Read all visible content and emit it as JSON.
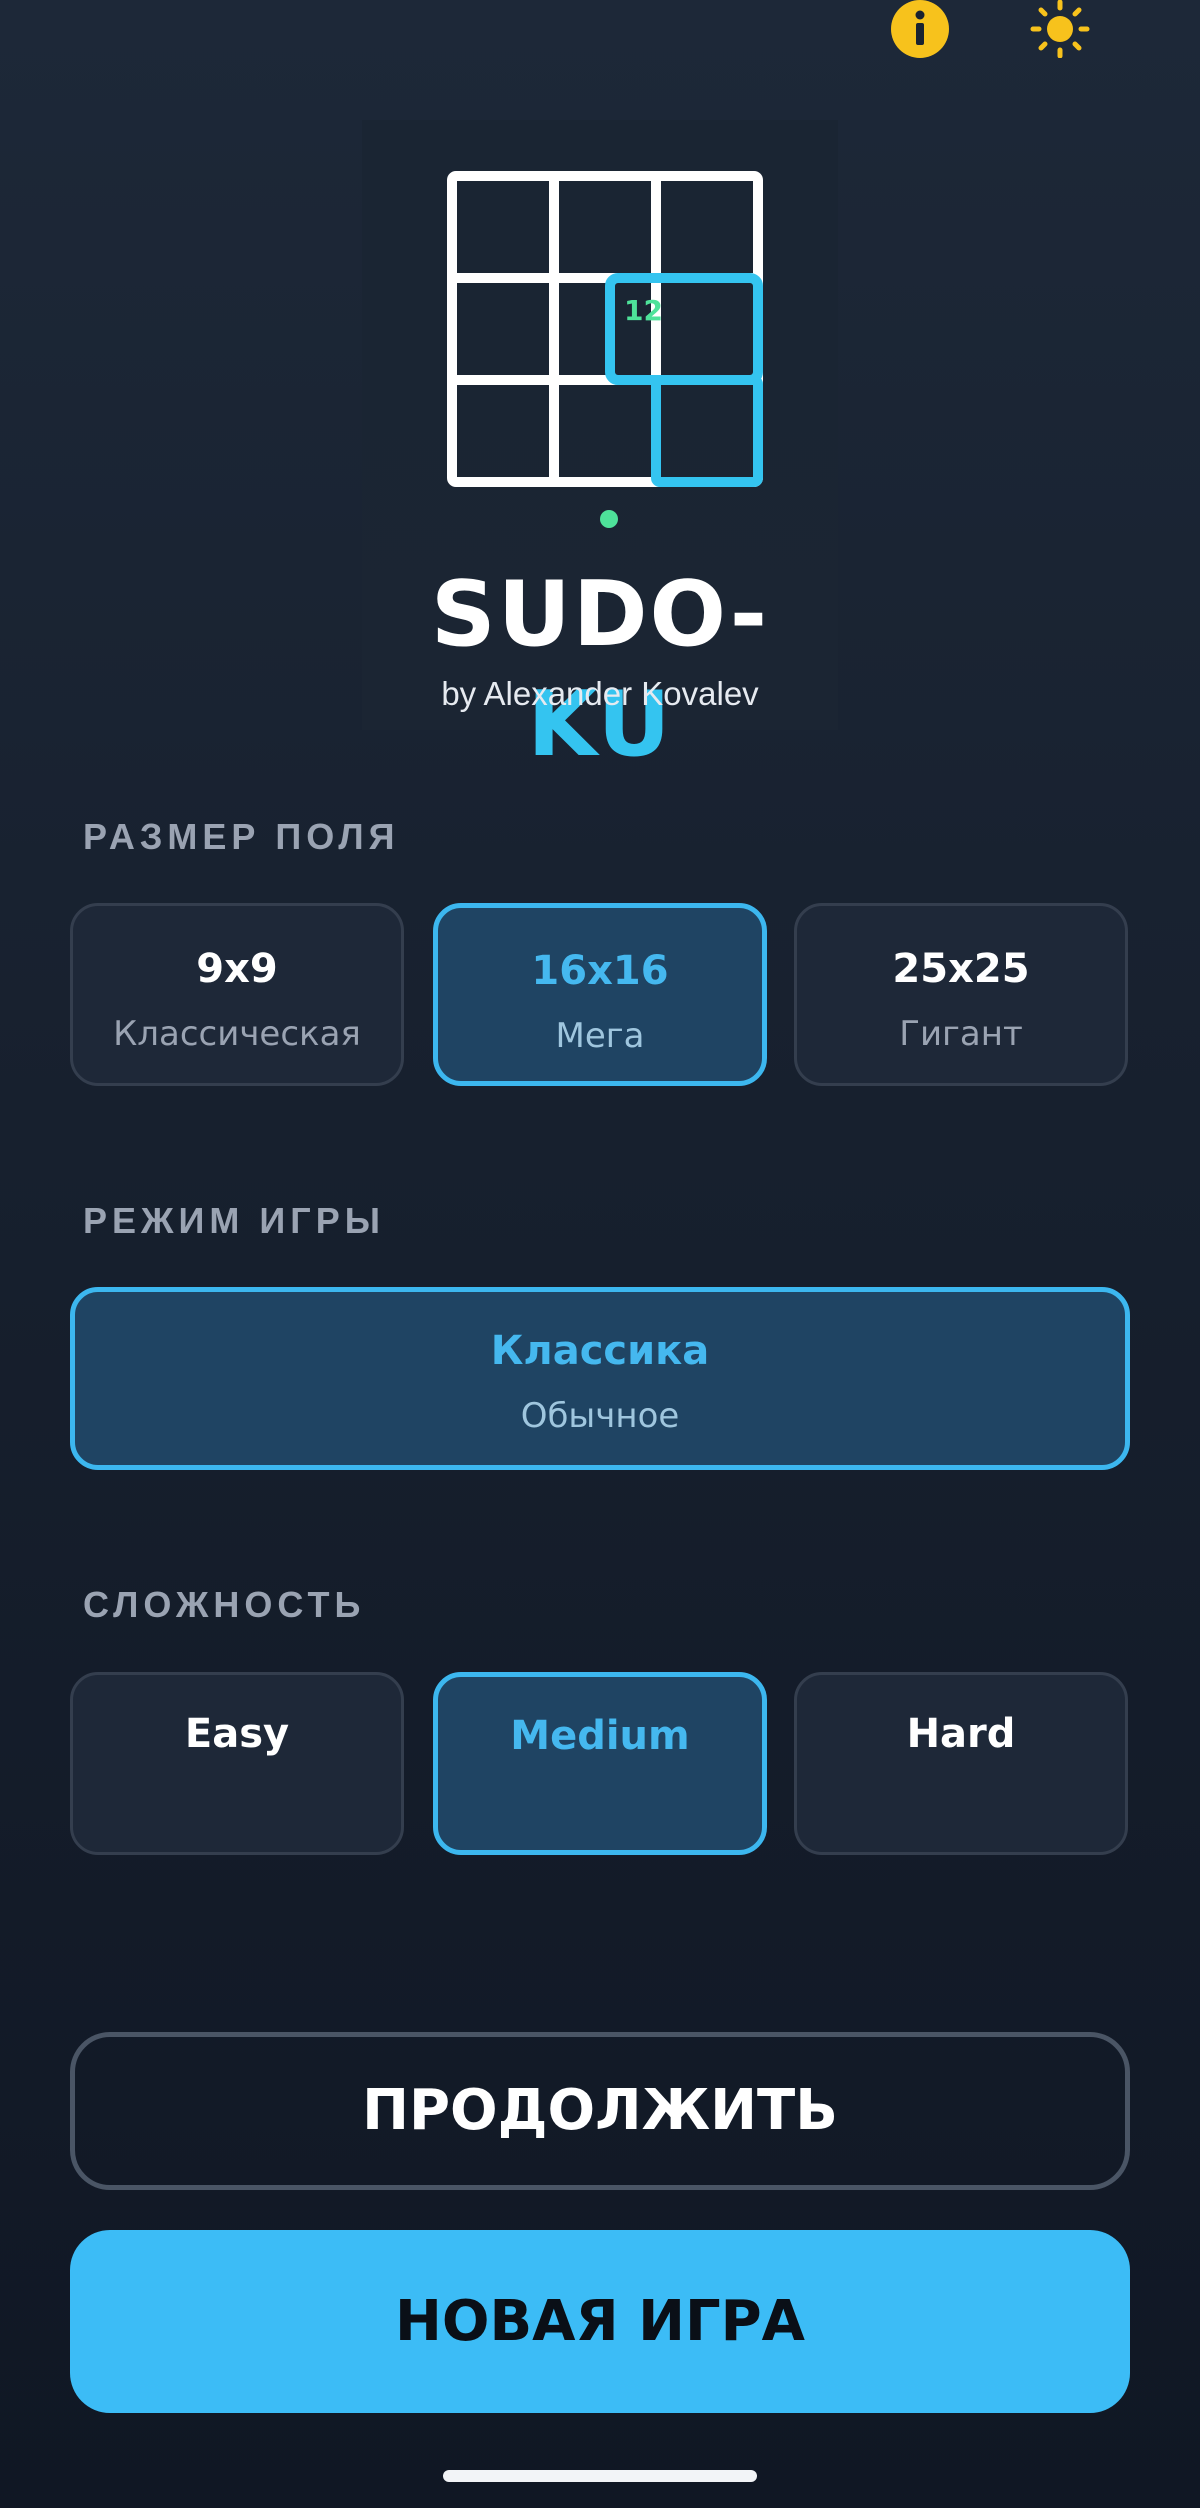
{
  "header": {
    "info_icon": "info-icon",
    "theme_icon": "sun-icon",
    "colors": {
      "icon_yellow": "#f7c21c"
    }
  },
  "logo": {
    "title_left": "SUDO-",
    "title_right": "KU",
    "subtitle": "by Alexander Kovalev",
    "grid_number": "12",
    "colors": {
      "accent": "#34c4f0",
      "dot": "#4ee29a"
    }
  },
  "board_size": {
    "label": "РАЗМЕР ПОЛЯ",
    "options": [
      {
        "title": "9x9",
        "subtitle": "Классическая",
        "selected": false
      },
      {
        "title": "16x16",
        "subtitle": "Мега",
        "selected": true
      },
      {
        "title": "25x25",
        "subtitle": "Гигант",
        "selected": false
      }
    ]
  },
  "game_mode": {
    "label": "РЕЖИМ ИГРЫ",
    "options": [
      {
        "title": "Классика",
        "subtitle": "Обычное",
        "selected": true
      }
    ]
  },
  "difficulty": {
    "label": "СЛОЖНОСТЬ",
    "options": [
      {
        "title": "Easy",
        "selected": false
      },
      {
        "title": "Medium",
        "selected": true
      },
      {
        "title": "Hard",
        "selected": false
      }
    ]
  },
  "actions": {
    "continue_label": "ПРОДОЛЖИТЬ",
    "new_game_label": "НОВАЯ ИГРА",
    "colors": {
      "primary": "#3cbcf6",
      "selected_border": "#3cb7ef"
    }
  }
}
